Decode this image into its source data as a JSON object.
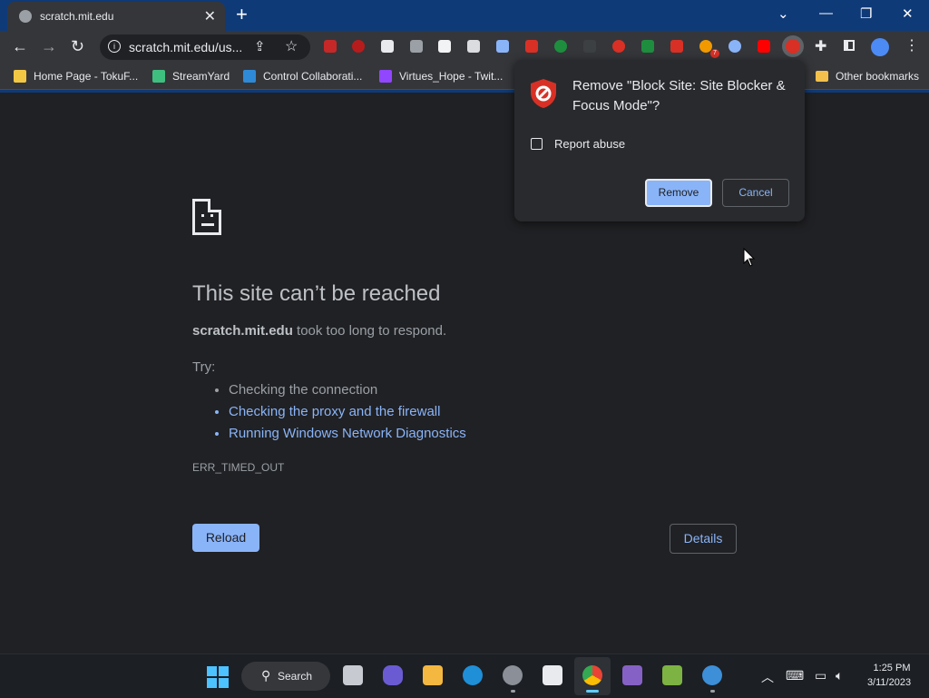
{
  "tab": {
    "title": "scratch.mit.edu",
    "close": "✕",
    "new_tab": "+"
  },
  "window": {
    "dropdown": "⌄",
    "minimize": "—",
    "restore": "❐",
    "close": "✕"
  },
  "toolbar": {
    "back": "←",
    "forward": "→",
    "reload": "↻",
    "url": "scratch.mit.edu/us...",
    "more": "⋮"
  },
  "extensions_badge": "7",
  "bookmarks": [
    {
      "label": "Home Page - TokuF...",
      "color": "#f2c744"
    },
    {
      "label": "StreamYard",
      "color": "#3fbf7f"
    },
    {
      "label": "Control Collaborati...",
      "color": "#2e8ad6"
    },
    {
      "label": "Virtues_Hope - Twit...",
      "color": "#9146ff"
    }
  ],
  "other_bookmarks": "Other bookmarks",
  "error": {
    "title": "This site can’t be reached",
    "host": "scratch.mit.edu",
    "message": " took too long to respond.",
    "try_label": "Try:",
    "suggestions": [
      "Checking the connection",
      "Checking the proxy and the firewall",
      "Running Windows Network Diagnostics"
    ],
    "code": "ERR_TIMED_OUT",
    "reload": "Reload",
    "details": "Details"
  },
  "dialog": {
    "title": "Remove \"Block Site: Site Blocker & Focus Mode\"?",
    "checkbox_label": "Report abuse",
    "remove": "Remove",
    "cancel": "Cancel"
  },
  "taskbar": {
    "search_label": "Search",
    "time": "1:25 PM",
    "date": "3/11/2023"
  }
}
